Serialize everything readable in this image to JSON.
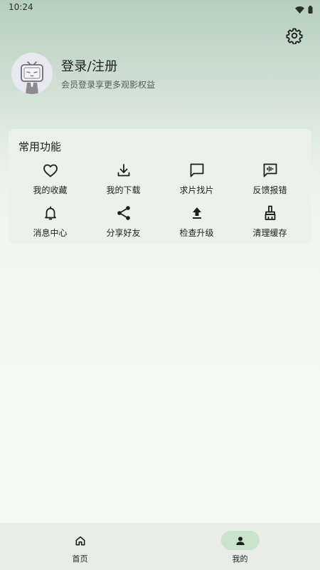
{
  "status_bar": {
    "time": "10:24",
    "icons": [
      "wifi-icon",
      "battery-icon"
    ]
  },
  "header": {
    "settings_icon": "gear-icon"
  },
  "profile": {
    "avatar_icon": "tv-mascot-avatar",
    "title": "登录/注册",
    "subtitle": "会员登录享更多观影权益"
  },
  "functions": {
    "title": "常用功能",
    "items": [
      {
        "label": "我的收藏",
        "icon": "heart-icon"
      },
      {
        "label": "我的下载",
        "icon": "download-icon"
      },
      {
        "label": "求片找片",
        "icon": "chat-bubble-icon"
      },
      {
        "label": "反馈报错",
        "icon": "feedback-icon"
      },
      {
        "label": "消息中心",
        "icon": "bell-icon"
      },
      {
        "label": "分享好友",
        "icon": "share-icon"
      },
      {
        "label": "检查升级",
        "icon": "upload-icon"
      },
      {
        "label": "清理缓存",
        "icon": "broom-icon"
      }
    ]
  },
  "bottom_nav": {
    "items": [
      {
        "label": "首页",
        "icon": "home-icon",
        "active": false
      },
      {
        "label": "我的",
        "icon": "person-icon",
        "active": true
      }
    ]
  },
  "colors": {
    "accent_pill": "#c9e3cd",
    "background_top": "#b6cfbc",
    "background_bottom": "#f5f9f3"
  }
}
